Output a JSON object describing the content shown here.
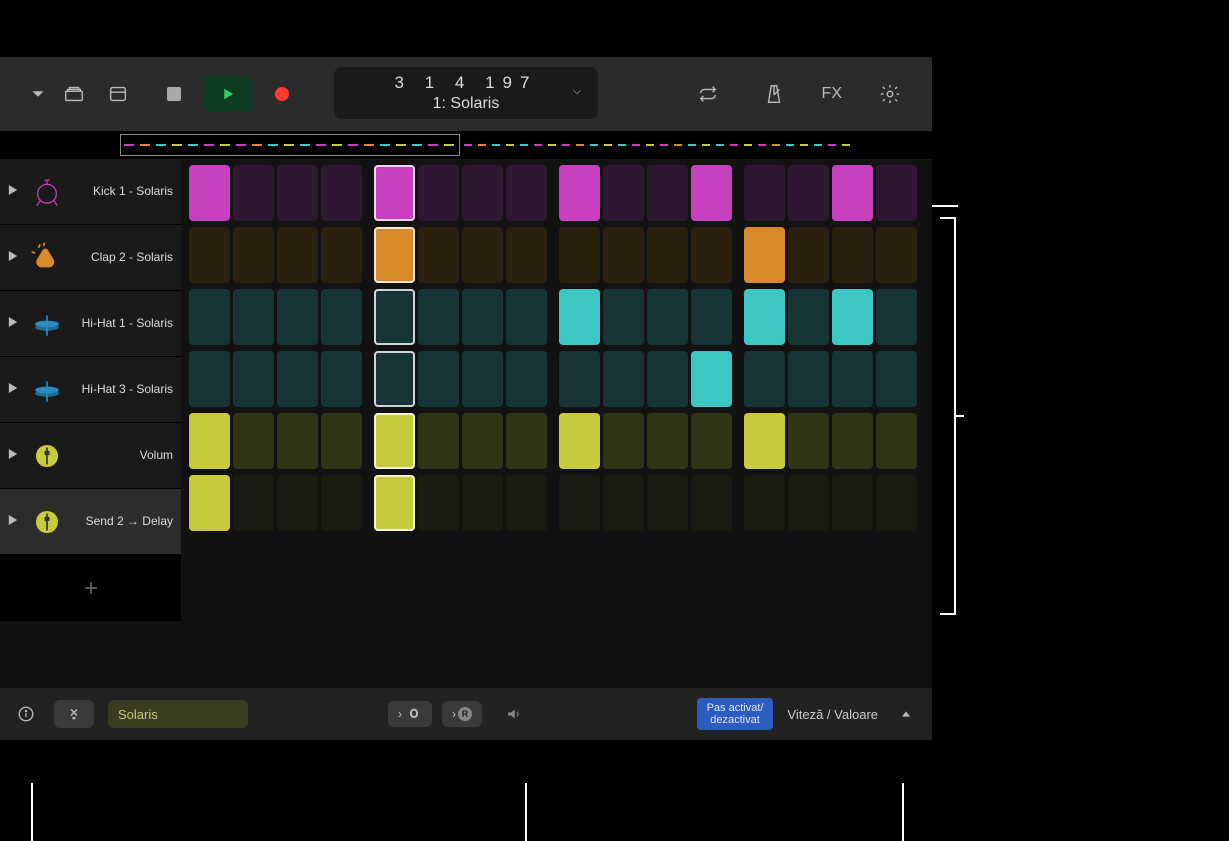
{
  "toolbar": {
    "position": "3  1  4  197",
    "pattern_label": "1: Solaris",
    "fx_label": "FX"
  },
  "tracks": [
    {
      "name": "Kick 1 - Solaris",
      "icon": "kick",
      "color_on": "#c83fc0",
      "color_off": "#2e1730",
      "steps": [
        1,
        0,
        0,
        0,
        1,
        0,
        0,
        0,
        1,
        0,
        0,
        1,
        0,
        0,
        1,
        0
      ]
    },
    {
      "name": "Clap 2 - Solaris",
      "icon": "clap",
      "color_on": "#d88a2a",
      "color_off": "#2b2010",
      "steps": [
        0,
        0,
        0,
        0,
        1,
        0,
        0,
        0,
        0,
        0,
        0,
        0,
        1,
        0,
        0,
        0
      ]
    },
    {
      "name": "Hi-Hat 1 - Solaris",
      "icon": "hihat",
      "color_on": "#3cc7c4",
      "color_off": "#173436",
      "steps": [
        0,
        0,
        0,
        0,
        0,
        0,
        0,
        0,
        1,
        0,
        0,
        0,
        1,
        0,
        1,
        0
      ]
    },
    {
      "name": "Hi-Hat 3 - Solaris",
      "icon": "hihat",
      "color_on": "#3cc7c4",
      "color_off": "#173436",
      "steps": [
        0,
        0,
        0,
        0,
        0,
        0,
        0,
        0,
        0,
        0,
        0,
        1,
        0,
        0,
        0,
        0
      ]
    },
    {
      "name": "Volum",
      "icon": "slider",
      "color_on": "#c7cc3e",
      "color_off": "#323417",
      "steps": [
        1,
        0,
        0,
        0,
        1,
        0,
        0,
        0,
        1,
        0,
        0,
        0,
        1,
        0,
        0,
        0
      ]
    },
    {
      "name": "Send 2 → Delay",
      "icon": "slider",
      "color_on": "#c7cc3e",
      "color_off": "#1e2012",
      "steps": [
        1,
        0,
        0,
        0,
        1,
        0,
        0,
        0,
        0,
        0,
        0,
        0,
        0,
        0,
        0,
        0
      ],
      "dim": true
    }
  ],
  "playhead_step": 5,
  "selected_track": 5,
  "footer": {
    "pattern_name": "Solaris",
    "step_toggle_label": "Pas activat/\ndezactivat",
    "velocity_label": "Viteză / Valoare",
    "midi_chip": "R"
  },
  "overview_colors": [
    "#c83fc0",
    "#d88a2a",
    "#3cc7c4",
    "#3cc7c4",
    "#c7cc3e",
    "#c7cc3e"
  ]
}
